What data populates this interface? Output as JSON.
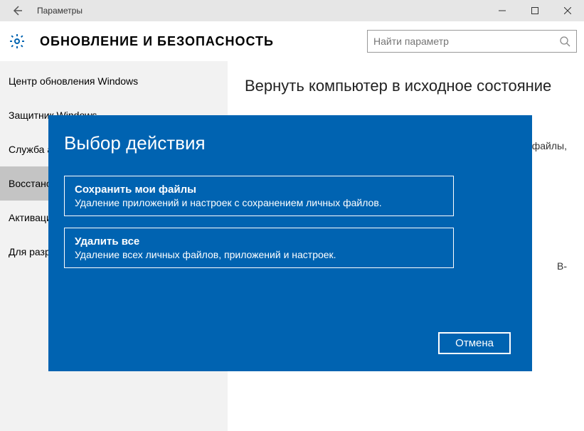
{
  "titlebar": {
    "title": "Параметры"
  },
  "header": {
    "heading": "ОБНОВЛЕНИЕ И БЕЗОПАСНОСТЬ",
    "search_placeholder": "Найти параметр"
  },
  "sidebar": {
    "items": [
      {
        "label": "Центр обновления Windows",
        "selected": false
      },
      {
        "label": "Защитник Windows",
        "selected": false
      },
      {
        "label": "Служба архивации",
        "selected": false
      },
      {
        "label": "Восстановление",
        "selected": true
      },
      {
        "label": "Активация",
        "selected": false
      },
      {
        "label": "Для разработчиков",
        "selected": false
      }
    ]
  },
  "content": {
    "heading": "Вернуть компьютер в исходное состояние",
    "body_fragment_1": "файлы,",
    "body_fragment_2": "В-"
  },
  "modal": {
    "title": "Выбор действия",
    "options": [
      {
        "title": "Сохранить мои файлы",
        "desc": "Удаление приложений и настроек с сохранением личных файлов."
      },
      {
        "title": "Удалить все",
        "desc": "Удаление всех личных файлов, приложений и настроек."
      }
    ],
    "cancel": "Отмена"
  },
  "colors": {
    "accent": "#0063b1"
  }
}
